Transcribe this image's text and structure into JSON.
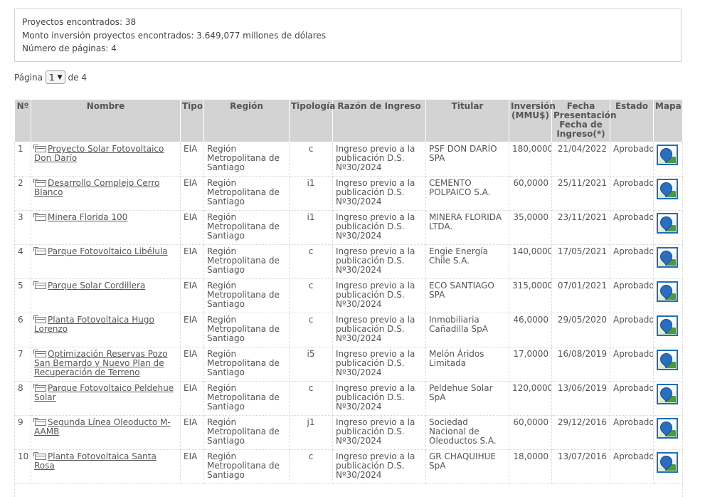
{
  "summary": {
    "found": "Proyectos encontrados: 38",
    "amount": "Monto inversión proyectos encontrados: 3.649,077 millones de dólares",
    "pages": "Número de páginas: 4"
  },
  "pager": {
    "label": "Página",
    "selected": "1",
    "of_label": "de 4"
  },
  "table": {
    "headers": {
      "n": "Nº",
      "nombre": "Nombre",
      "tipo": "Tipo",
      "region": "Región",
      "tipologia": "Tipología",
      "razon": "Razón de Ingreso",
      "titular": "Titular",
      "inversion": "Inversión (MMU$)",
      "fecha": "Fecha Presentación Fecha de Ingreso(*)",
      "estado": "Estado",
      "mapa": "Mapa"
    },
    "rows": [
      {
        "n": "1",
        "nombre": "Proyecto Solar Fotovoltaico Don Darío",
        "tipo": "EIA",
        "region": "Región Metropolitana de Santiago",
        "tipologia": "c",
        "razon": "Ingreso previo a la publicación D.S. Nº30/2024",
        "titular": "PSF DON DARÍO SPA",
        "inversion": "180,0000",
        "fecha": "21/04/2022",
        "estado": "Aprobado"
      },
      {
        "n": "2",
        "nombre": "Desarrollo Complejo Cerro Blanco",
        "tipo": "EIA",
        "region": "Región Metropolitana de Santiago",
        "tipologia": "i1",
        "razon": "Ingreso previo a la publicación D.S. Nº30/2024",
        "titular": "CEMENTO POLPAICO S.A.",
        "inversion": "60,0000",
        "fecha": "25/11/2021",
        "estado": "Aprobado"
      },
      {
        "n": "3",
        "nombre": "Minera Florida 100",
        "tipo": "EIA",
        "region": "Región Metropolitana de Santiago",
        "tipologia": "i1",
        "razon": "Ingreso previo a la publicación D.S. Nº30/2024",
        "titular": "MINERA FLORIDA LTDA.",
        "inversion": "35,0000",
        "fecha": "23/11/2021",
        "estado": "Aprobado"
      },
      {
        "n": "4",
        "nombre": "Parque Fotovoltaico Libélula",
        "tipo": "EIA",
        "region": "Región Metropolitana de Santiago",
        "tipologia": "c",
        "razon": "Ingreso previo a la publicación D.S. Nº30/2024",
        "titular": "Engie Energía Chile S.A.",
        "inversion": "140,0000",
        "fecha": "17/05/2021",
        "estado": "Aprobado"
      },
      {
        "n": "5",
        "nombre": "Parque Solar Cordillera",
        "tipo": "EIA",
        "region": "Región Metropolitana de Santiago",
        "tipologia": "c",
        "razon": "Ingreso previo a la publicación D.S. Nº30/2024",
        "titular": "ECO SANTIAGO SPA",
        "inversion": "315,0000",
        "fecha": "07/01/2021",
        "estado": "Aprobado"
      },
      {
        "n": "6",
        "nombre": "Planta Fotovoltaica Hugo Lorenzo",
        "tipo": "EIA",
        "region": "Región Metropolitana de Santiago",
        "tipologia": "c",
        "razon": "Ingreso previo a la publicación D.S. Nº30/2024",
        "titular": "Inmobiliaria Cañadilla SpA",
        "inversion": "46,0000",
        "fecha": "29/05/2020",
        "estado": "Aprobado"
      },
      {
        "n": "7",
        "nombre": "Optimización Reservas Pozo San Bernardo y Nuevo Plan de Recuperación de Terreno",
        "tipo": "EIA",
        "region": "Región Metropolitana de Santiago",
        "tipologia": "i5",
        "razon": "Ingreso previo a la publicación D.S. Nº30/2024",
        "titular": "Melón Áridos Limitada",
        "inversion": "17,0000",
        "fecha": "16/08/2019",
        "estado": "Aprobado"
      },
      {
        "n": "8",
        "nombre": "Parque Fotovoltaico Peldehue Solar",
        "tipo": "EIA",
        "region": "Región Metropolitana de Santiago",
        "tipologia": "c",
        "razon": "Ingreso previo a la publicación D.S. Nº30/2024",
        "titular": "Peldehue Solar SpA",
        "inversion": "120,0000",
        "fecha": "13/06/2019",
        "estado": "Aprobado"
      },
      {
        "n": "9",
        "nombre": "Segunda Línea Oleoducto M-AAMB",
        "tipo": "EIA",
        "region": "Región Metropolitana de Santiago",
        "tipologia": "j1",
        "razon": "Ingreso previo a la publicación D.S. Nº30/2024",
        "titular": "Sociedad Nacional de Oleoductos S.A.",
        "inversion": "60,0000",
        "fecha": "29/12/2016",
        "estado": "Aprobado"
      },
      {
        "n": "10",
        "nombre": "Planta Fotovoltaica Santa Rosa",
        "tipo": "EIA",
        "region": "Región Metropolitana de Santiago",
        "tipologia": "c",
        "razon": "Ingreso previo a la publicación D.S. Nº30/2024",
        "titular": "GR CHAQUIHUE SpA",
        "inversion": "18,0000",
        "fecha": "13/07/2016",
        "estado": "Aprobado"
      }
    ]
  },
  "icons": {
    "window": "new-window-icon",
    "map": "map-pin-icon"
  }
}
